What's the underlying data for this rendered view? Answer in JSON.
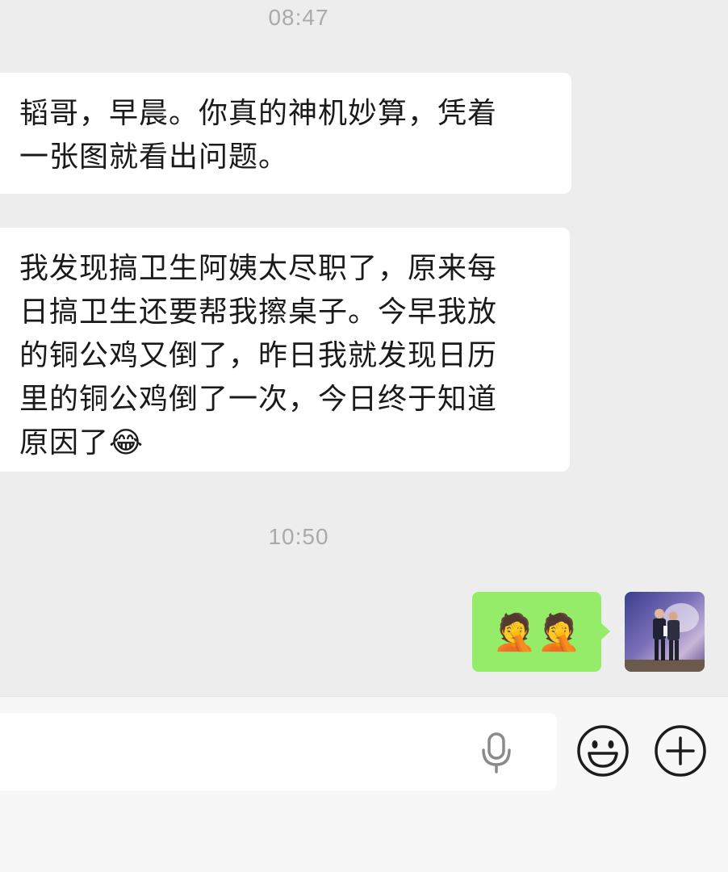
{
  "chat": {
    "timestamps": [
      "08:47",
      "10:50"
    ],
    "messages": [
      {
        "side": "left",
        "lines": [
          "韬哥，早晨。你真的神机妙算，凭着",
          "一张图就看出问题。"
        ]
      },
      {
        "side": "left",
        "lines": [
          "我发现搞卫生阿姨太尽职了，原来每",
          "日搞卫生还要帮我擦桌子。今早我放",
          "的铜公鸡又倒了，昨日我就发现日历",
          "里的铜公鸡倒了一次，今日终于知道",
          "原因了😂"
        ]
      },
      {
        "side": "right",
        "text": "🤦🤦"
      }
    ]
  },
  "icons": {
    "voice": "microphone-icon",
    "emoji": "smiley-icon",
    "more": "plus-circle-icon"
  },
  "colors": {
    "background": "#ededed",
    "incoming_bubble": "#ffffff",
    "outgoing_bubble": "#95ec69",
    "timestamp": "#aaaaaa"
  }
}
